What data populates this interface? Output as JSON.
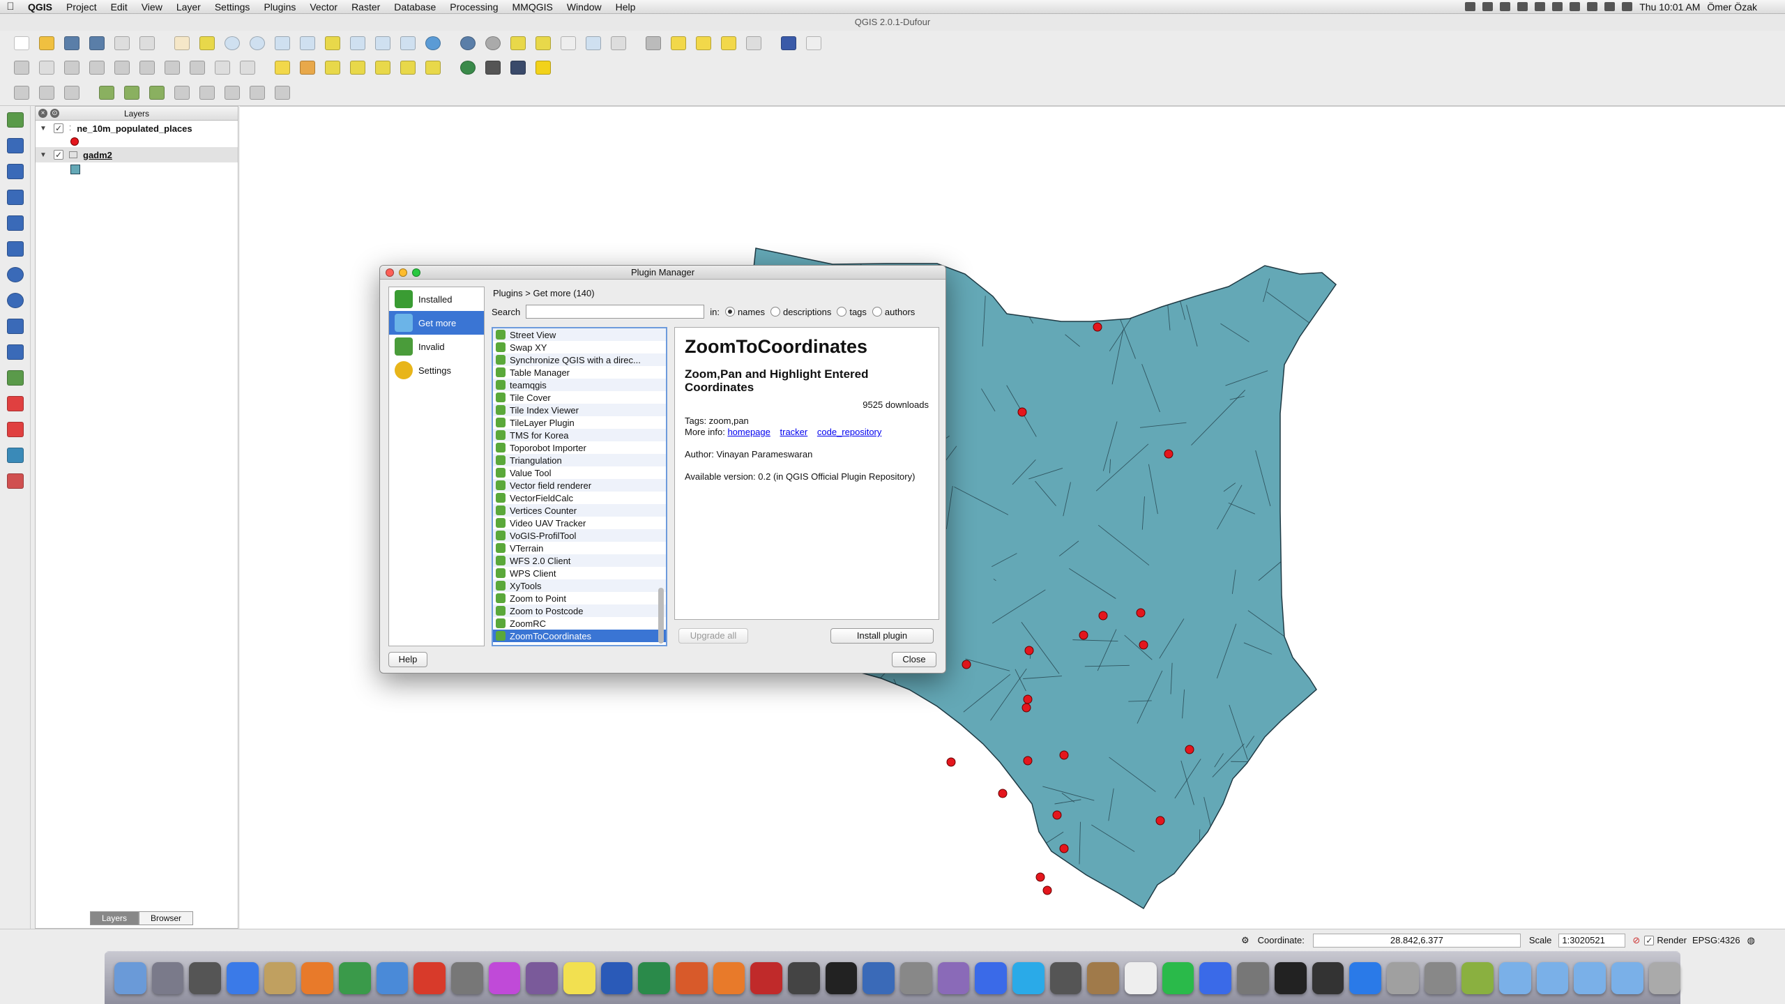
{
  "menubar": {
    "app": "QGIS",
    "items": [
      "Project",
      "Edit",
      "View",
      "Layer",
      "Settings",
      "Plugins",
      "Vector",
      "Raster",
      "Database",
      "Processing",
      "MMQGIS",
      "Window",
      "Help"
    ],
    "clock": "Thu 10:01 AM",
    "user": "Ömer Özak"
  },
  "window": {
    "title": "QGIS 2.0.1-Dufour"
  },
  "layers_panel": {
    "title": "Layers",
    "layers": [
      {
        "name": "ne_10m_populated_places",
        "checked": true,
        "symbol": "point-red"
      },
      {
        "name": "gadm2",
        "checked": true,
        "symbol": "polygon-teal"
      }
    ],
    "tabs": [
      "Layers",
      "Browser"
    ]
  },
  "plugin_manager": {
    "title": "Plugin Manager",
    "nav": [
      {
        "label": "Installed",
        "icon": "puzzle-installed-icon",
        "color": "#3a9c33"
      },
      {
        "label": "Get more",
        "icon": "puzzle-get-more-icon",
        "color": "#6bb4e8"
      },
      {
        "label": "Invalid",
        "icon": "puzzle-invalid-icon",
        "color": "#4a9c3a"
      },
      {
        "label": "Settings",
        "icon": "settings-gear-icon",
        "color": "#e8b51a"
      }
    ],
    "breadcrumb": "Plugins > Get more (140)",
    "search_label": "Search",
    "search_value": "",
    "in_label": "in:",
    "radio": [
      {
        "label": "names",
        "on": true
      },
      {
        "label": "descriptions",
        "on": false
      },
      {
        "label": "tags",
        "on": false
      },
      {
        "label": "authors",
        "on": false
      }
    ],
    "plugins": [
      "Street View",
      "Swap XY",
      "Synchronize QGIS with a direc...",
      "Table Manager",
      "teamqgis",
      "Tile Cover",
      "Tile Index Viewer",
      "TileLayer Plugin",
      "TMS for Korea",
      "Toporobot Importer",
      "Triangulation",
      "Value Tool",
      "Vector field renderer",
      "VectorFieldCalc",
      "Vertices Counter",
      "Video UAV Tracker",
      "VoGIS-ProfilTool",
      "VTerrain",
      "WFS 2.0 Client",
      "WPS Client",
      "XyTools",
      "Zoom to Point",
      "Zoom to Postcode",
      "ZoomRC",
      "ZoomToCoordinates"
    ],
    "selected_plugin": "ZoomToCoordinates",
    "detail": {
      "name": "ZoomToCoordinates",
      "description": "Zoom,Pan and Highlight Entered Coordinates",
      "downloads": "9525 downloads",
      "tags": "Tags: zoom,pan",
      "more_info_label": "More info:",
      "links": [
        "homepage",
        "tracker",
        "code_repository"
      ],
      "author": "Author: Vinayan Parameswaran",
      "available": "Available version: 0.2 (in QGIS Official Plugin Repository)"
    },
    "buttons": {
      "upgrade_all": "Upgrade all",
      "install": "Install plugin",
      "help": "Help",
      "close": "Close"
    }
  },
  "statusbar": {
    "coordinate_label": "Coordinate:",
    "coordinate": "28.842,6.377",
    "scale_label": "Scale",
    "scale": "1:3020521",
    "render_label": "Render",
    "crs": "EPSG:4326"
  },
  "colors": {
    "map_fill": "#64a8b6",
    "map_stroke": "#1f3a44",
    "point": "#e4161d",
    "selection": "#3a75d4"
  },
  "dock_icons": [
    "finder-icon",
    "launchpad-icon",
    "app-icon",
    "app-store-icon",
    "preview-icon",
    "firefox-icon",
    "chrome-icon",
    "safari-icon",
    "acrobat-icon",
    "tex-icon",
    "flower-icon",
    "app-icon",
    "notes-icon",
    "word-icon",
    "excel-icon",
    "powerpoint-icon",
    "matlab-icon",
    "mathematica-icon",
    "ipython-icon",
    "terminal-icon",
    "r-icon",
    "grid-icon",
    "app-icon",
    "xcode-icon",
    "skype-icon",
    "facetime-icon",
    "contacts-icon",
    "calendar-icon",
    "spotify-icon",
    "itunes-icon",
    "system-prefs-icon",
    "console-icon",
    "activity-monitor-icon",
    "teamviewer-icon",
    "person-icon",
    "grid-icon",
    "qgis-icon",
    "folder-icon",
    "folder-icon",
    "folder-icon",
    "folder-icon",
    "trash-icon"
  ]
}
